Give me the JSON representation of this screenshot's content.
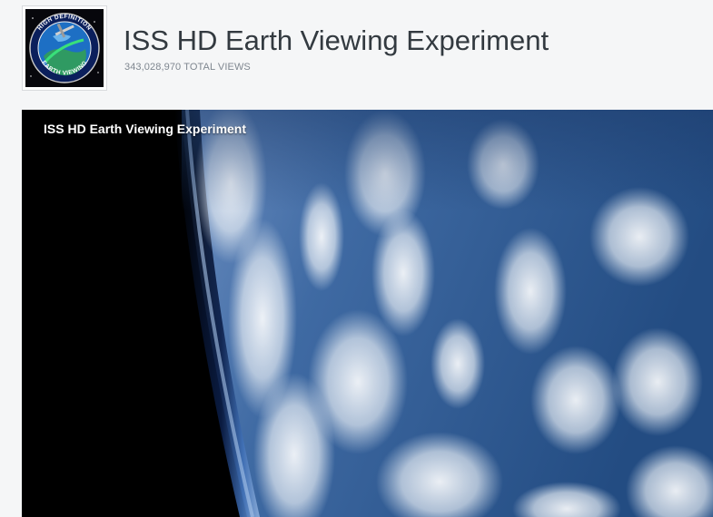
{
  "channel": {
    "title": "ISS HD Earth Viewing Experiment",
    "total_views": "343,028,970 TOTAL VIEWS",
    "logo": {
      "icon": "hdev-mission-patch-icon",
      "ring_text": "HIGH DEFINITION EARTH VIEWING"
    }
  },
  "player": {
    "title": "ISS HD Earth Viewing Experiment",
    "scene": "earth-from-orbit-image"
  },
  "colors": {
    "page_background": "#f5f6f7",
    "title_text": "#333a40",
    "views_text": "#7f8790",
    "ocean": "#2d5a8e",
    "clouds": "#e9eef4",
    "space": "#000000"
  }
}
